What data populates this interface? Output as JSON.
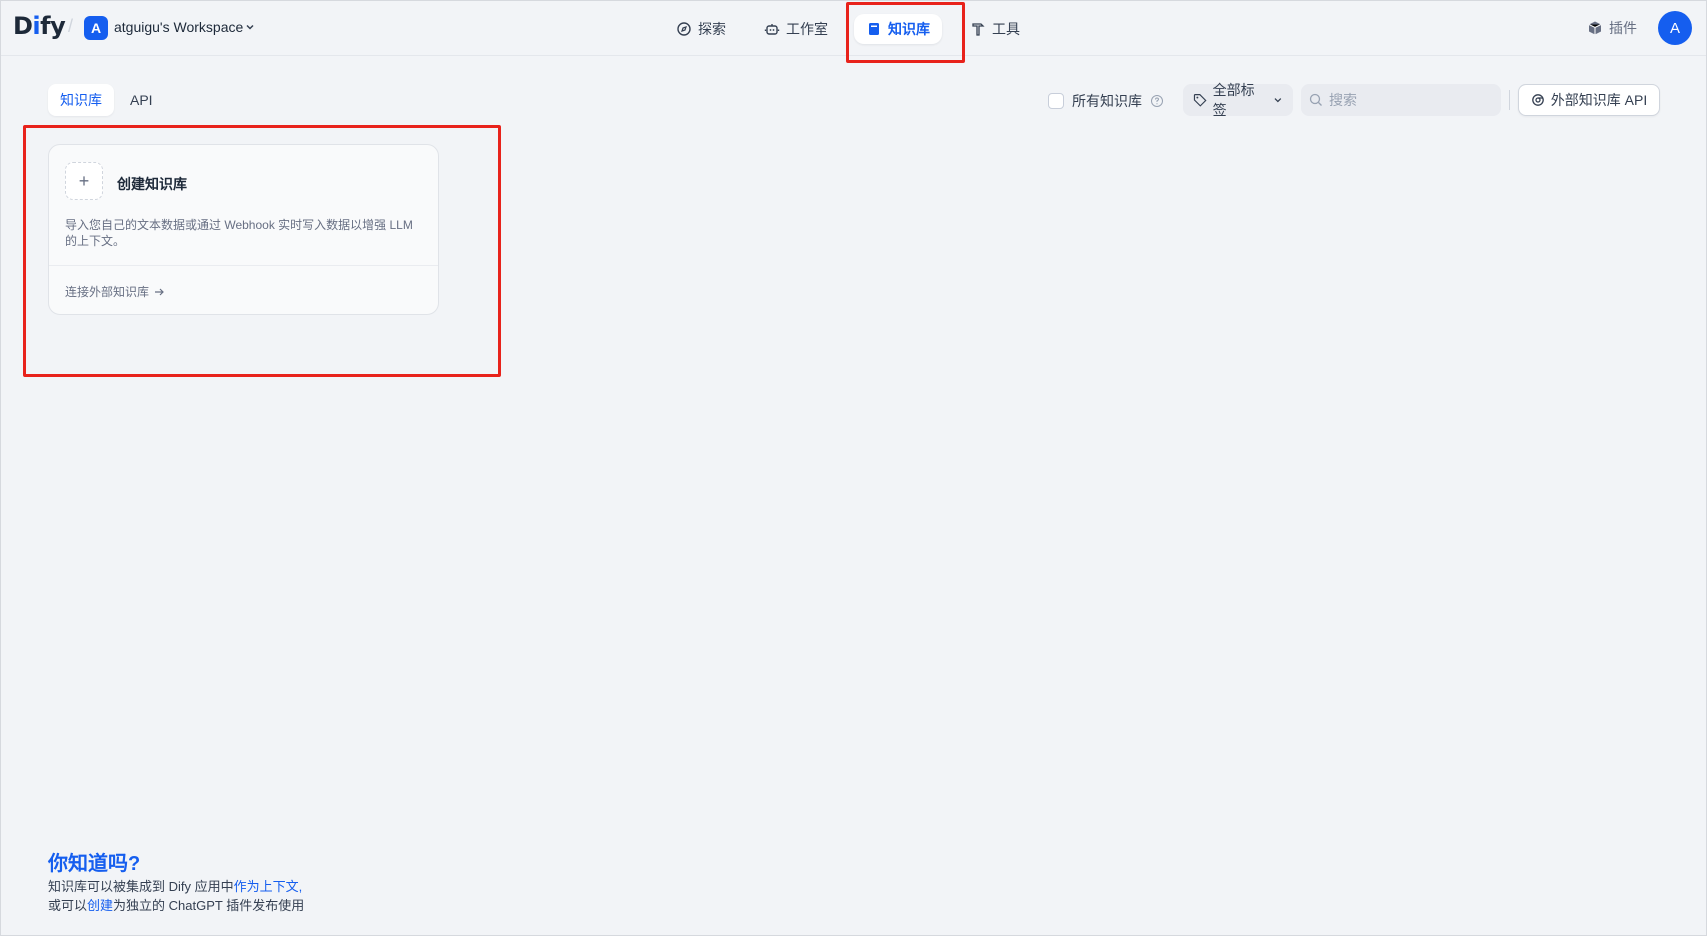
{
  "header": {
    "logo_prefix": "D",
    "logo_i": "i",
    "logo_suffix": "fy",
    "workspace_initial": "A",
    "workspace_name": "atguigu's Workspace",
    "nav": [
      {
        "label": "探索",
        "icon": "compass-icon"
      },
      {
        "label": "工作室",
        "icon": "robot-icon"
      },
      {
        "label": "知识库",
        "icon": "book-icon",
        "active": true
      },
      {
        "label": "工具",
        "icon": "hammer-icon"
      }
    ],
    "plugin_label": "插件",
    "avatar_initial": "A"
  },
  "toolbar": {
    "tabs": [
      {
        "label": "知识库",
        "active": true
      },
      {
        "label": "API",
        "active": false
      }
    ],
    "all_datasets_label": "所有知识库",
    "tag_filter_label": "全部标签",
    "search_placeholder": "搜索",
    "external_api_label": "外部知识库 API"
  },
  "create_card": {
    "title": "创建知识库",
    "description": "导入您自己的文本数据或通过 Webhook 实时写入数据以增强 LLM 的上下文。",
    "connect_link": "连接外部知识库"
  },
  "hint": {
    "title": "你知道吗?",
    "line1_a": "知识库可以被集成到 Dify 应用中",
    "line1_link": "作为上下文,",
    "line2_a": "或可以",
    "line2_link": "创建",
    "line2_b": "为独立的 ChatGPT 插件发布使用"
  },
  "colors": {
    "accent": "#155eef",
    "highlight": "#e8221b",
    "background": "#f2f4f7"
  }
}
